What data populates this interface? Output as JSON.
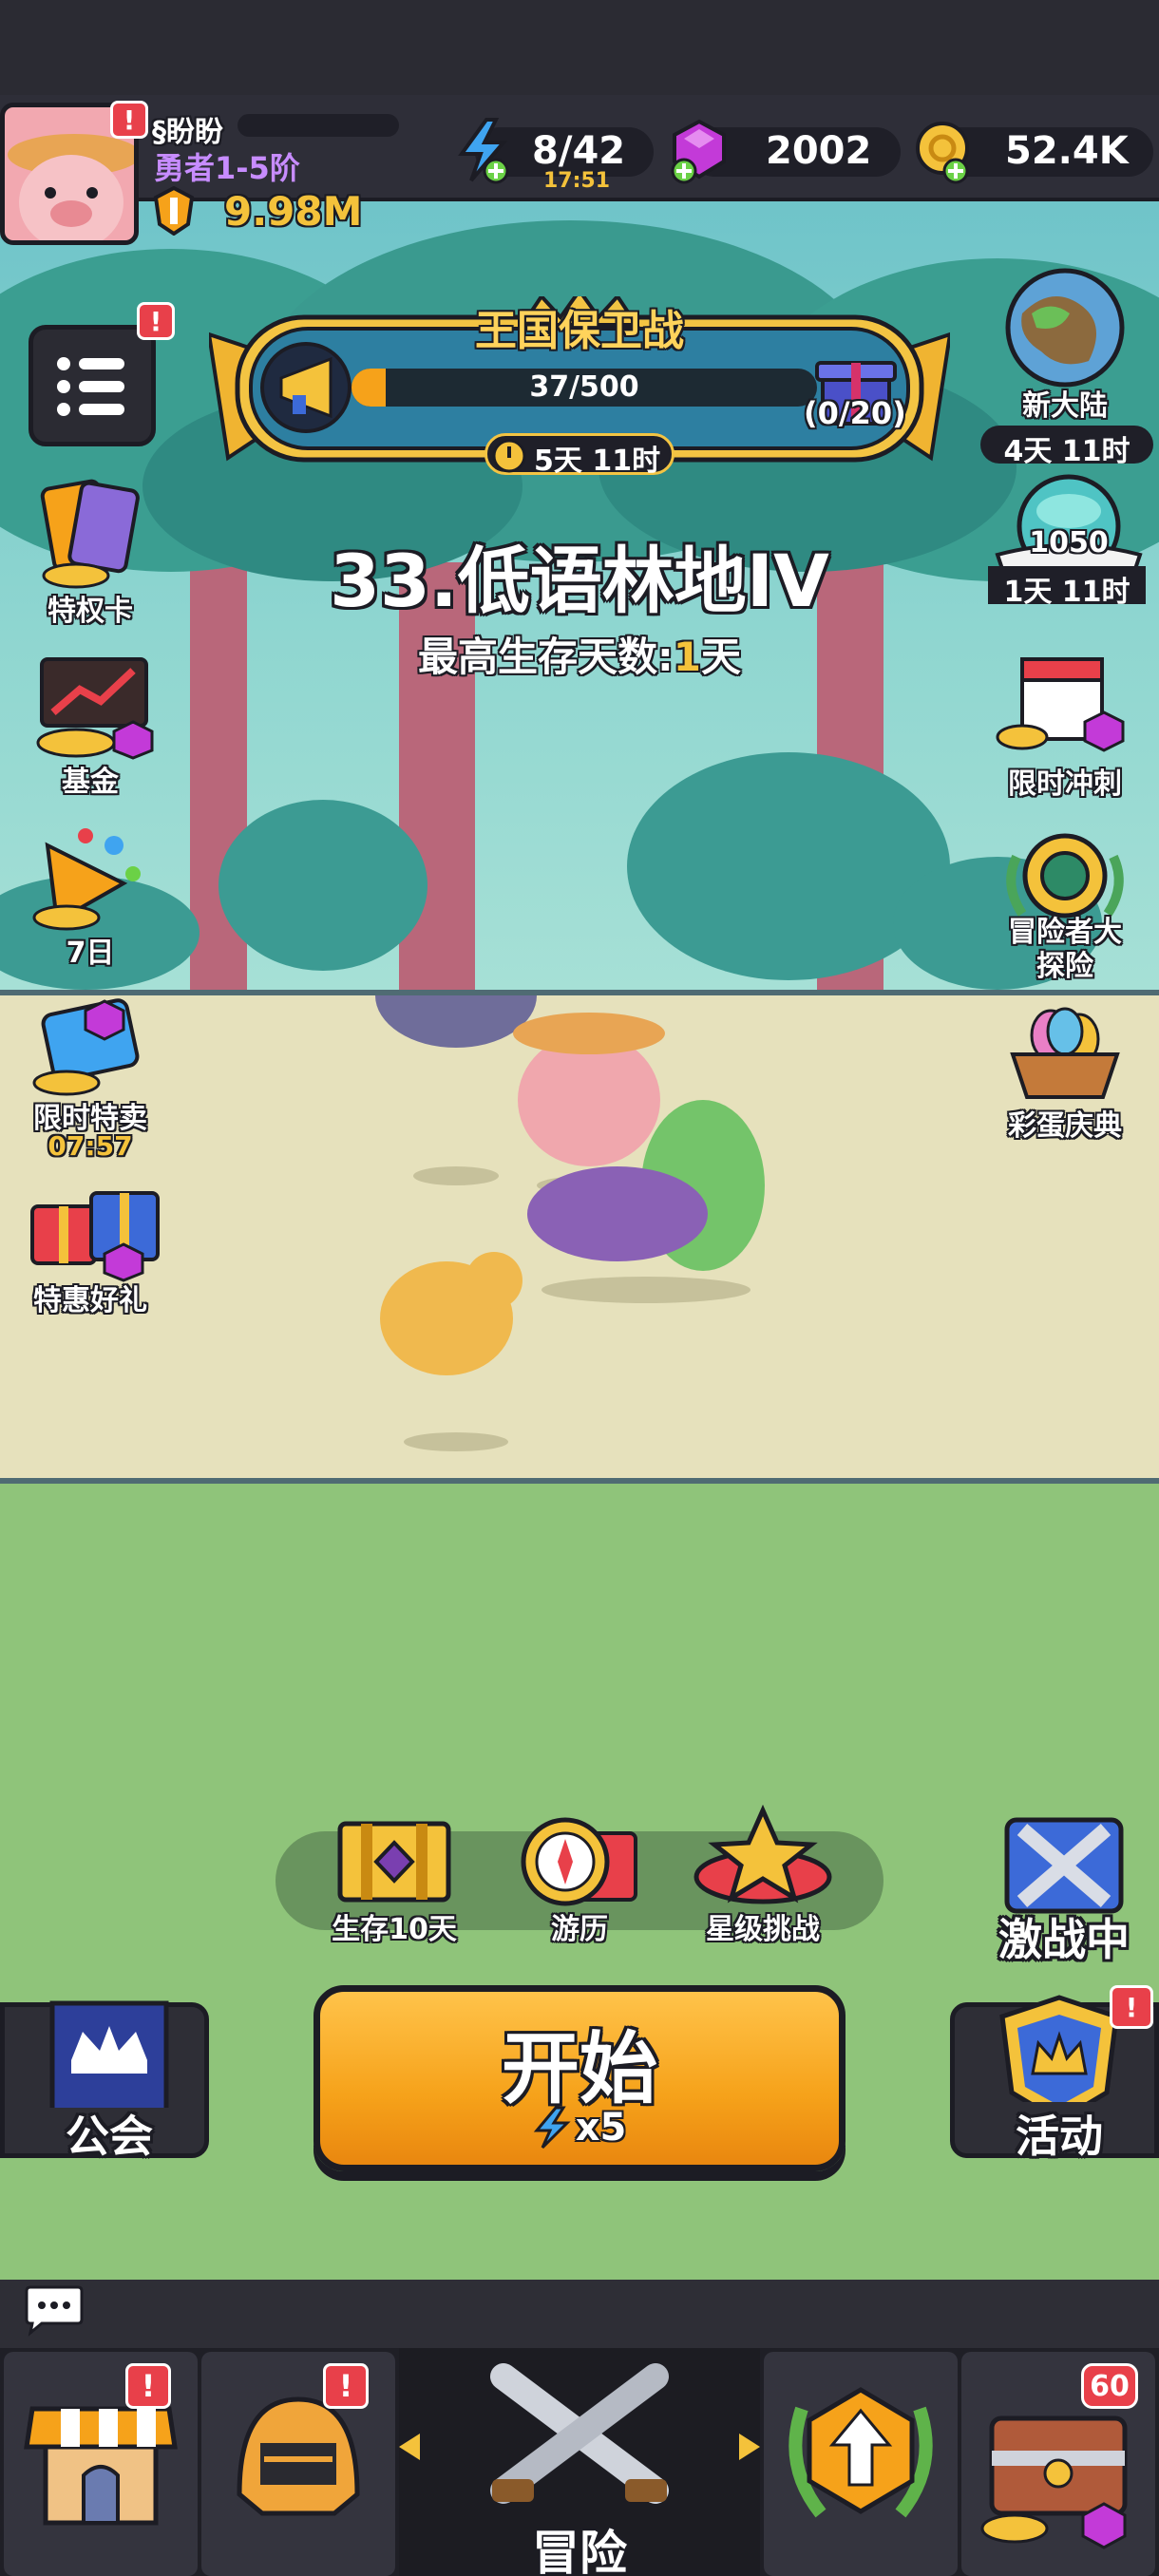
{
  "player": {
    "name": "§盼盼",
    "rank": "勇者1-5阶",
    "power": "9.98M",
    "avatar_badge": "!"
  },
  "resources": {
    "energy": "8/42",
    "energy_timer": "17:51",
    "gems": "2002",
    "gold": "52.4K"
  },
  "event": {
    "title": "王国保卫战",
    "progress": "37/500",
    "progress_fraction": 0.074,
    "reward_count": "(0/20)",
    "timer": "5天 11时"
  },
  "menu_badge": "!",
  "stage": {
    "title": "33.低语林地IV",
    "best_label": "最高生存天数:",
    "best_value": "1",
    "best_unit": "天"
  },
  "left_side": [
    {
      "label": "特权卡"
    },
    {
      "label": "基金"
    },
    {
      "label": "7日"
    },
    {
      "label": "限时特卖",
      "timer": "07:57"
    },
    {
      "label": "特惠好礼"
    }
  ],
  "right_side": {
    "new_continent": {
      "label": "新大陆",
      "timer": "4天 11时"
    },
    "orb": {
      "value": "1050",
      "timer": "1天 11时"
    },
    "sprint": {
      "label": "限时冲刺"
    },
    "adventurer": {
      "label": "冒险者大\n探险"
    },
    "easter": {
      "label": "彩蛋庆典"
    }
  },
  "modes": [
    {
      "label": "生存10天"
    },
    {
      "label": "游历"
    },
    {
      "label": "星级挑战"
    }
  ],
  "battle": {
    "label": "激战中"
  },
  "guild": {
    "label": "公会"
  },
  "activity": {
    "label": "活动",
    "badge": "!"
  },
  "start": {
    "label": "开始",
    "cost": "x5"
  },
  "bottom_nav": [
    {
      "name": "shop",
      "badge": "!"
    },
    {
      "name": "equipment",
      "badge": "!"
    },
    {
      "name": "adventure",
      "label": "冒险"
    },
    {
      "name": "upgrade"
    },
    {
      "name": "chest",
      "badge": "60"
    }
  ],
  "colors": {
    "accent_orange": "#f6a21a",
    "gold": "#f4c23b",
    "badge_red": "#e8404a",
    "purple_rank": "#c78cff"
  }
}
